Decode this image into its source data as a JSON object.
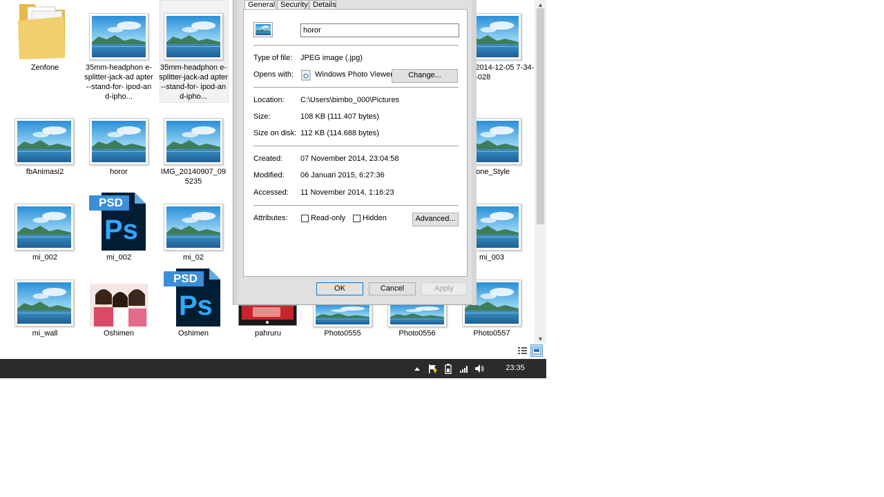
{
  "explorer": {
    "tiles": [
      {
        "name": "Zenfone"
      },
      {
        "name": "35mm-headphon e-splitter-jack-ad apter--stand-for- ipod-and-ipho..."
      },
      {
        "name": "35mm-headphon e-splitter-jack-ad apter--stand-for- ipod-and-ipho..."
      },
      {
        "name": "0_2014-12-05 7-34-35-028"
      },
      {
        "name": "fbAnimasi2"
      },
      {
        "name": "horor"
      },
      {
        "name": "IMG_20140907_09 5235"
      },
      {
        "name": "hone_Style"
      },
      {
        "name": "mi_002"
      },
      {
        "name": "mi_002"
      },
      {
        "name": "mi_02"
      },
      {
        "name": "mi_003"
      },
      {
        "name": "mi_wall"
      },
      {
        "name": "Oshimen"
      },
      {
        "name": "Oshimen"
      },
      {
        "name": "pahruru"
      },
      {
        "name": "Photo0555"
      },
      {
        "name": "Photo0556"
      },
      {
        "name": "Photo0557"
      }
    ],
    "psd_label": "PSD",
    "ps_label": "Ps"
  },
  "dialog": {
    "tabs": [
      "General",
      "Security",
      "Details"
    ],
    "file_name": "horor",
    "type_label": "Type of file:",
    "type_value": "JPEG image (.jpg)",
    "opens_label": "Opens with:",
    "opens_value": "Windows Photo Viewer",
    "change_button": "Change...",
    "location_label": "Location:",
    "location_value": "C:\\Users\\bimbo_000\\Pictures",
    "size_label": "Size:",
    "size_value": "108 KB (111.407 bytes)",
    "disk_label": "Size on disk:",
    "disk_value": "112 KB (114.688 bytes)",
    "created_label": "Created:",
    "created_value": "07 November 2014, 23:04:58",
    "modified_label": "Modified:",
    "modified_value": "06 Januari 2015, 6:27:36",
    "accessed_label": "Accessed:",
    "accessed_value": "11 November 2014, 1:16:23",
    "attributes_label": "Attributes:",
    "readonly_label": "Read-only",
    "hidden_label": "Hidden",
    "advanced_button": "Advanced...",
    "ok_button": "OK",
    "cancel_button": "Cancel",
    "apply_button": "Apply"
  },
  "taskbar": {
    "clock": "23:35"
  },
  "colors": {
    "taskbar": "#2b2b2b",
    "accent": "#0078d7"
  }
}
